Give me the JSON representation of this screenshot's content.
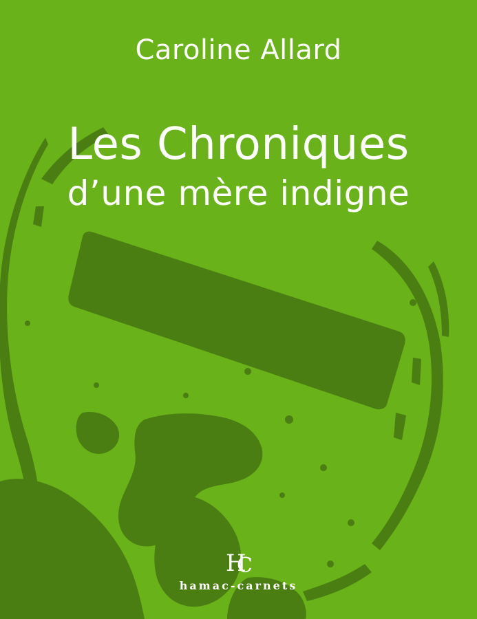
{
  "colors": {
    "background": "#6ab219",
    "shadow": "#4a7e13",
    "text": "#ffffff"
  },
  "book": {
    "author": "Caroline Allard",
    "title_line1": "Les Chroniques",
    "title_line2": "d’une mère indigne"
  },
  "publisher": {
    "name": "hamac-carnets"
  },
  "artwork": {
    "description_icon": "no-entry-sign-stencil"
  }
}
